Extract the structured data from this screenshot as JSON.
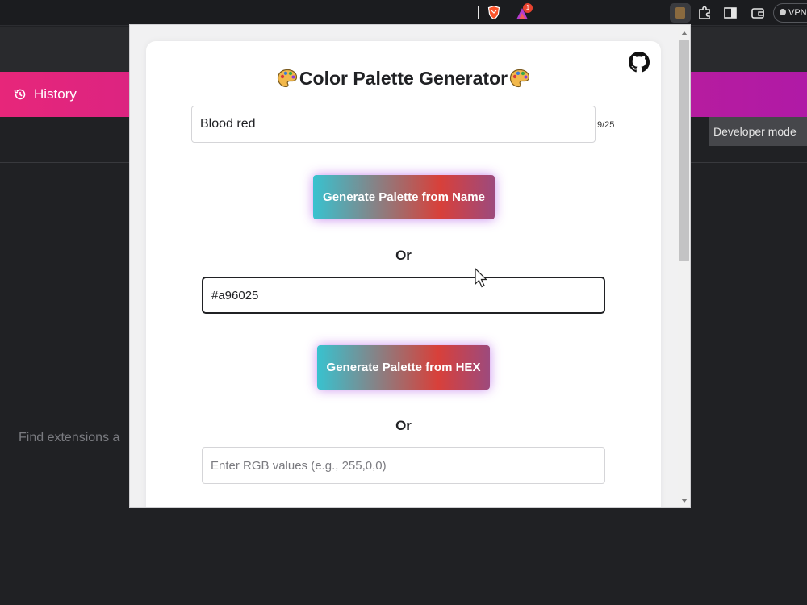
{
  "browser": {
    "rewards_badge": "1",
    "vpn_label": "VPN"
  },
  "background_page": {
    "history_label": "History",
    "developer_mode_label": "Developer mode",
    "search_hint": "Find extensions a"
  },
  "popup": {
    "title": "Color Palette Generator",
    "name_input": {
      "value": "Blood red",
      "counter": "9/25"
    },
    "generate_name_label": "Generate Palette from Name",
    "or_label": "Or",
    "hex_input": {
      "value": "#a96025"
    },
    "generate_hex_label": "Generate Palette from HEX",
    "rgb_input": {
      "placeholder": "Enter RGB values (e.g., 255,0,0)"
    }
  },
  "colors": {
    "band_gradient_start": "#e7267a",
    "band_gradient_end": "#b01aa6",
    "button_gradient_start": "#38c2cf",
    "button_gradient_mid": "#d8403a",
    "button_gradient_end": "#9d4a7d"
  }
}
